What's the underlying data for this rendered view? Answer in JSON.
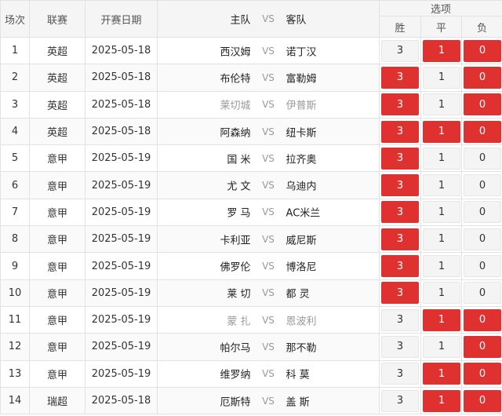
{
  "header": {
    "round": "场次",
    "league": "联赛",
    "date": "开赛日期",
    "home": "主队",
    "vs": "VS",
    "away": "客队",
    "options": "选项",
    "win": "胜",
    "draw": "平",
    "lose": "负"
  },
  "colors": {
    "selected": "#e03131",
    "unselected": "#f4f4f4"
  },
  "rows": [
    {
      "no": "1",
      "league": "英超",
      "date": "2025-05-18",
      "home": "西汉姆",
      "away": "诺丁汉",
      "dim": false,
      "w": "3",
      "d": "1",
      "l": "0",
      "sel": [
        false,
        true,
        true
      ]
    },
    {
      "no": "2",
      "league": "英超",
      "date": "2025-05-18",
      "home": "布伦特",
      "away": "富勒姆",
      "dim": false,
      "w": "3",
      "d": "1",
      "l": "0",
      "sel": [
        true,
        false,
        true
      ]
    },
    {
      "no": "3",
      "league": "英超",
      "date": "2025-05-18",
      "home": "莱切城",
      "away": "伊普斯",
      "dim": true,
      "w": "3",
      "d": "1",
      "l": "0",
      "sel": [
        true,
        false,
        true
      ]
    },
    {
      "no": "4",
      "league": "英超",
      "date": "2025-05-18",
      "home": "阿森纳",
      "away": "纽卡斯",
      "dim": false,
      "w": "3",
      "d": "1",
      "l": "0",
      "sel": [
        true,
        true,
        true
      ]
    },
    {
      "no": "5",
      "league": "意甲",
      "date": "2025-05-19",
      "home": "国 米",
      "away": "拉齐奥",
      "dim": false,
      "w": "3",
      "d": "1",
      "l": "0",
      "sel": [
        true,
        false,
        false
      ]
    },
    {
      "no": "6",
      "league": "意甲",
      "date": "2025-05-19",
      "home": "尤 文",
      "away": "乌迪内",
      "dim": false,
      "w": "3",
      "d": "1",
      "l": "0",
      "sel": [
        true,
        false,
        false
      ]
    },
    {
      "no": "7",
      "league": "意甲",
      "date": "2025-05-19",
      "home": "罗 马",
      "away": "AC米兰",
      "dim": false,
      "w": "3",
      "d": "1",
      "l": "0",
      "sel": [
        true,
        false,
        false
      ]
    },
    {
      "no": "8",
      "league": "意甲",
      "date": "2025-05-19",
      "home": "卡利亚",
      "away": "威尼斯",
      "dim": false,
      "w": "3",
      "d": "1",
      "l": "0",
      "sel": [
        true,
        false,
        false
      ]
    },
    {
      "no": "9",
      "league": "意甲",
      "date": "2025-05-19",
      "home": "佛罗伦",
      "away": "博洛尼",
      "dim": false,
      "w": "3",
      "d": "1",
      "l": "0",
      "sel": [
        true,
        false,
        false
      ]
    },
    {
      "no": "10",
      "league": "意甲",
      "date": "2025-05-19",
      "home": "莱 切",
      "away": "都 灵",
      "dim": false,
      "w": "3",
      "d": "1",
      "l": "0",
      "sel": [
        true,
        false,
        false
      ]
    },
    {
      "no": "11",
      "league": "意甲",
      "date": "2025-05-19",
      "home": "蒙 扎",
      "away": "恩波利",
      "dim": true,
      "w": "3",
      "d": "1",
      "l": "0",
      "sel": [
        false,
        true,
        true
      ]
    },
    {
      "no": "12",
      "league": "意甲",
      "date": "2025-05-19",
      "home": "帕尔马",
      "away": "那不勒",
      "dim": false,
      "w": "3",
      "d": "1",
      "l": "0",
      "sel": [
        false,
        false,
        true
      ]
    },
    {
      "no": "13",
      "league": "意甲",
      "date": "2025-05-19",
      "home": "维罗纳",
      "away": "科 莫",
      "dim": false,
      "w": "3",
      "d": "1",
      "l": "0",
      "sel": [
        false,
        true,
        true
      ]
    },
    {
      "no": "14",
      "league": "瑞超",
      "date": "2025-05-18",
      "home": "厄斯特",
      "away": "盖 斯",
      "dim": false,
      "w": "3",
      "d": "1",
      "l": "0",
      "sel": [
        false,
        true,
        true
      ]
    }
  ]
}
